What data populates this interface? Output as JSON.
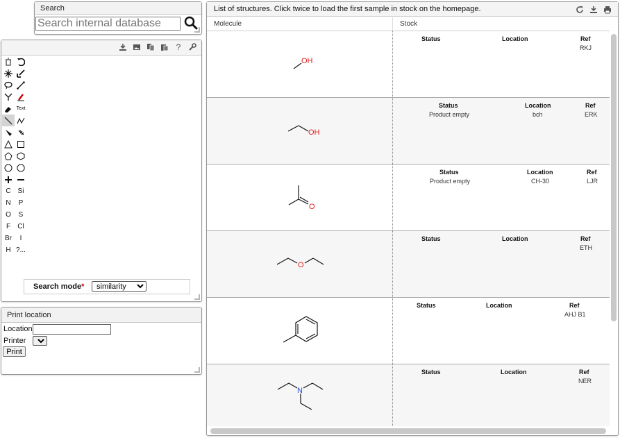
{
  "search": {
    "title": "Search",
    "placeholder": "Search internal database"
  },
  "sketcher": {
    "toolbar_icons": [
      "download-icon",
      "image-icon",
      "copy-icon",
      "paste-icon",
      "help-icon",
      "wrench-icon"
    ],
    "help_glyph": "?",
    "text_tool": "Text",
    "atoms": [
      [
        "C",
        "Si"
      ],
      [
        "N",
        "P"
      ],
      [
        "O",
        "S"
      ],
      [
        "F",
        "Cl"
      ],
      [
        "Br",
        "I"
      ],
      [
        "H",
        "?..."
      ]
    ],
    "search_mode_label": "Search mode",
    "search_mode_required": "*",
    "search_mode_value": "similarity"
  },
  "print_location": {
    "title": "Print location",
    "location_label": "Location",
    "printer_label": "Printer",
    "print_button": "Print"
  },
  "structures": {
    "title": "List of structures. Click twice to load the first sample in stock on the homepage.",
    "col_molecule": "Molecule",
    "col_stock": "Stock",
    "stock_headers": {
      "status": "Status",
      "location": "Location",
      "ref": "Ref"
    },
    "rows": [
      {
        "molecule": "methanol",
        "status": "",
        "location": "",
        "ref": "RKJ"
      },
      {
        "molecule": "ethanol",
        "status": "Product empty",
        "location": "bch",
        "ref": "ERK"
      },
      {
        "molecule": "acetone",
        "status": "Product empty",
        "location": "CH-30",
        "ref": "LJR"
      },
      {
        "molecule": "diethyl-ether",
        "status": "",
        "location": "",
        "ref": "ETH"
      },
      {
        "molecule": "toluene",
        "status": "",
        "location": "",
        "ref": "AHJ B1"
      },
      {
        "molecule": "triethylamine",
        "status": "",
        "location": "",
        "ref": "NER"
      }
    ]
  },
  "atom_labels": {
    "oh": "OH",
    "o": "O",
    "n": "N"
  },
  "colors": {
    "oxygen": "#e02020",
    "nitrogen": "#2050d0"
  }
}
